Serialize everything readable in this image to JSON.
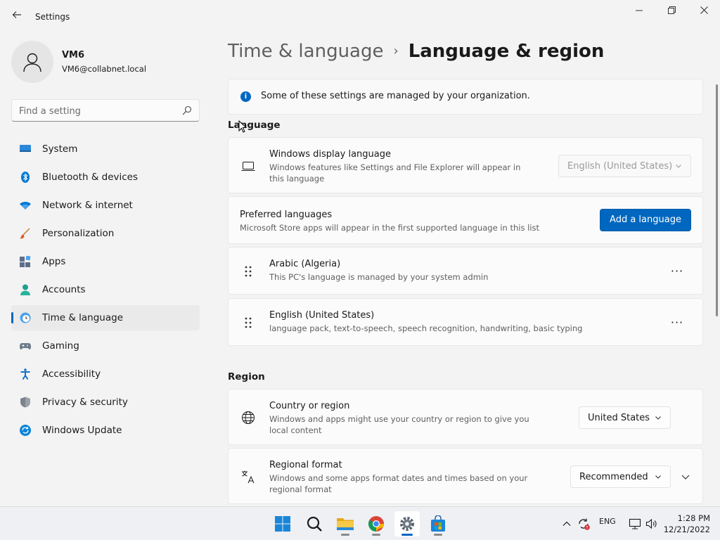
{
  "window": {
    "title": "Settings",
    "minimize": "—",
    "maximize": "❐",
    "close": "✕"
  },
  "profile": {
    "name": "VM6",
    "email": "VM6@collabnet.local"
  },
  "search": {
    "placeholder": "Find a setting"
  },
  "nav": {
    "items": [
      {
        "label": "System",
        "icon": "monitor-icon"
      },
      {
        "label": "Bluetooth & devices",
        "icon": "bluetooth-icon"
      },
      {
        "label": "Network & internet",
        "icon": "wifi-icon"
      },
      {
        "label": "Personalization",
        "icon": "brush-icon"
      },
      {
        "label": "Apps",
        "icon": "apps-icon"
      },
      {
        "label": "Accounts",
        "icon": "person-icon"
      },
      {
        "label": "Time & language",
        "icon": "clock-globe-icon",
        "active": true
      },
      {
        "label": "Gaming",
        "icon": "gamepad-icon"
      },
      {
        "label": "Accessibility",
        "icon": "accessibility-icon"
      },
      {
        "label": "Privacy & security",
        "icon": "shield-icon"
      },
      {
        "label": "Windows Update",
        "icon": "update-icon"
      }
    ]
  },
  "breadcrumb": {
    "parent": "Time & language",
    "separator": "›",
    "current": "Language & region"
  },
  "info": {
    "text": "Some of these settings are managed by your organization."
  },
  "language": {
    "heading": "Language",
    "display_language": {
      "title": "Windows display language",
      "desc": "Windows features like Settings and File Explorer will appear in this language",
      "value": "English (United States)"
    },
    "preferred": {
      "title": "Preferred languages",
      "desc": "Microsoft Store apps will appear in the first supported language in this list",
      "button": "Add a language"
    },
    "list": [
      {
        "name": "Arabic (Algeria)",
        "desc": "This PC's language is managed by your system admin"
      },
      {
        "name": "English (United States)",
        "desc": "language pack, text-to-speech, speech recognition, handwriting, basic typing"
      }
    ],
    "more": "···"
  },
  "region": {
    "heading": "Region",
    "country": {
      "title": "Country or region",
      "desc": "Windows and apps might use your country or region to give you local content",
      "value": "United States"
    },
    "format": {
      "title": "Regional format",
      "desc": "Windows and some apps format dates and times based on your regional format",
      "value": "Recommended"
    }
  },
  "taskbar": {
    "apps": [
      "start-icon",
      "search-icon",
      "file-explorer-icon",
      "chrome-icon",
      "settings-icon",
      "store-icon"
    ],
    "tray_lang": "ENG",
    "time": "1:28 PM",
    "date": "12/21/2022"
  },
  "colors": {
    "accent": "#0067c0",
    "background": "#f3f3f3",
    "card": "#fbfbfb"
  }
}
